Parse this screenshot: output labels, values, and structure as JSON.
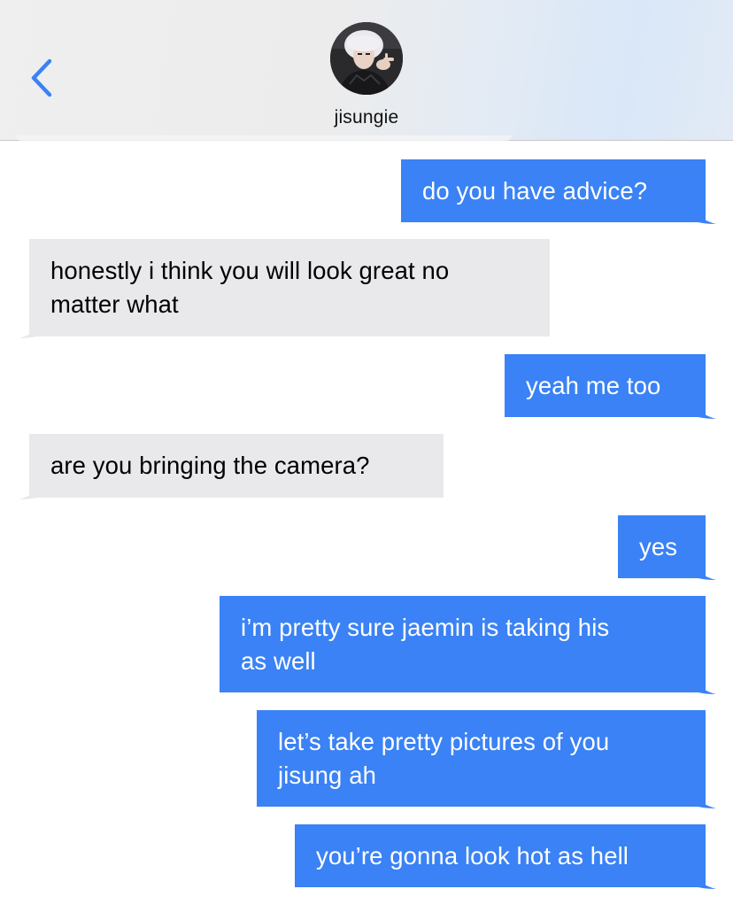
{
  "header": {
    "contact_name": "jisungie",
    "back_icon": "chevron-left-icon",
    "accent_color": "#3a82f5"
  },
  "colors": {
    "sent_bubble": "#3a82f5",
    "received_bubble": "#e9e9eb",
    "sent_text": "#ffffff",
    "received_text": "#000000"
  },
  "messages": [
    {
      "direction": "sent",
      "text": "do you have advice?"
    },
    {
      "direction": "received",
      "text": "honestly i think you will look great no\nmatter what"
    },
    {
      "direction": "sent",
      "text": "yeah me too"
    },
    {
      "direction": "received",
      "text": "are you bringing the camera?"
    },
    {
      "direction": "sent",
      "text": "yes"
    },
    {
      "direction": "sent",
      "text": "i’m pretty sure jaemin is taking his\nas well"
    },
    {
      "direction": "sent",
      "text": "let’s take pretty pictures of you\njisung ah"
    },
    {
      "direction": "sent",
      "text": "you’re gonna look hot as hell"
    }
  ]
}
